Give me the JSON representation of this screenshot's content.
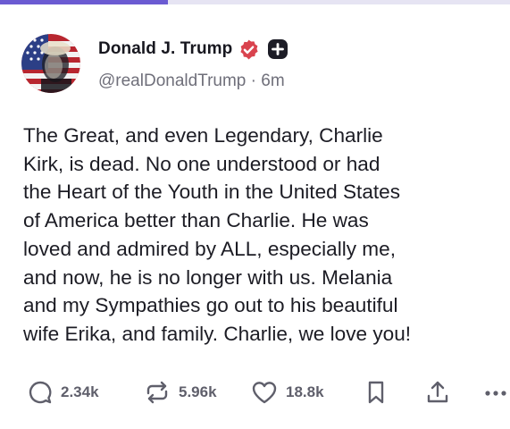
{
  "progress": {
    "fraction": 0.33,
    "fill_color": "#6b5bd2",
    "track_color": "#e6e4f3"
  },
  "author": {
    "display_name": "Donald J. Trump",
    "handle": "@realDonaldTrump",
    "separator": "·",
    "time_ago": "6m",
    "verified_badge_color": "#d9434e",
    "verified_icon": "verified-badge-icon",
    "follow_icon": "plus-icon",
    "avatar_icon": "avatar"
  },
  "post": {
    "lines": [
      "The Great, and even Legendary, Charlie",
      "Kirk, is dead. No one understood or had",
      "the Heart of the Youth in the United States",
      "of America better than Charlie. He was",
      "loved and admired by ALL, especially me,",
      "and now, he is no longer with us. Melania",
      "and my Sympathies go out to his beautiful",
      "wife Erika, and family. Charlie, we love you!"
    ]
  },
  "actions": {
    "replies": {
      "icon": "reply-icon",
      "count": "2.34k"
    },
    "retruths": {
      "icon": "retruth-icon",
      "count": "5.96k"
    },
    "likes": {
      "icon": "heart-icon",
      "count": "18.8k"
    },
    "bookmark": {
      "icon": "bookmark-icon"
    },
    "share": {
      "icon": "share-icon"
    },
    "more": {
      "icon": "more-icon"
    }
  }
}
